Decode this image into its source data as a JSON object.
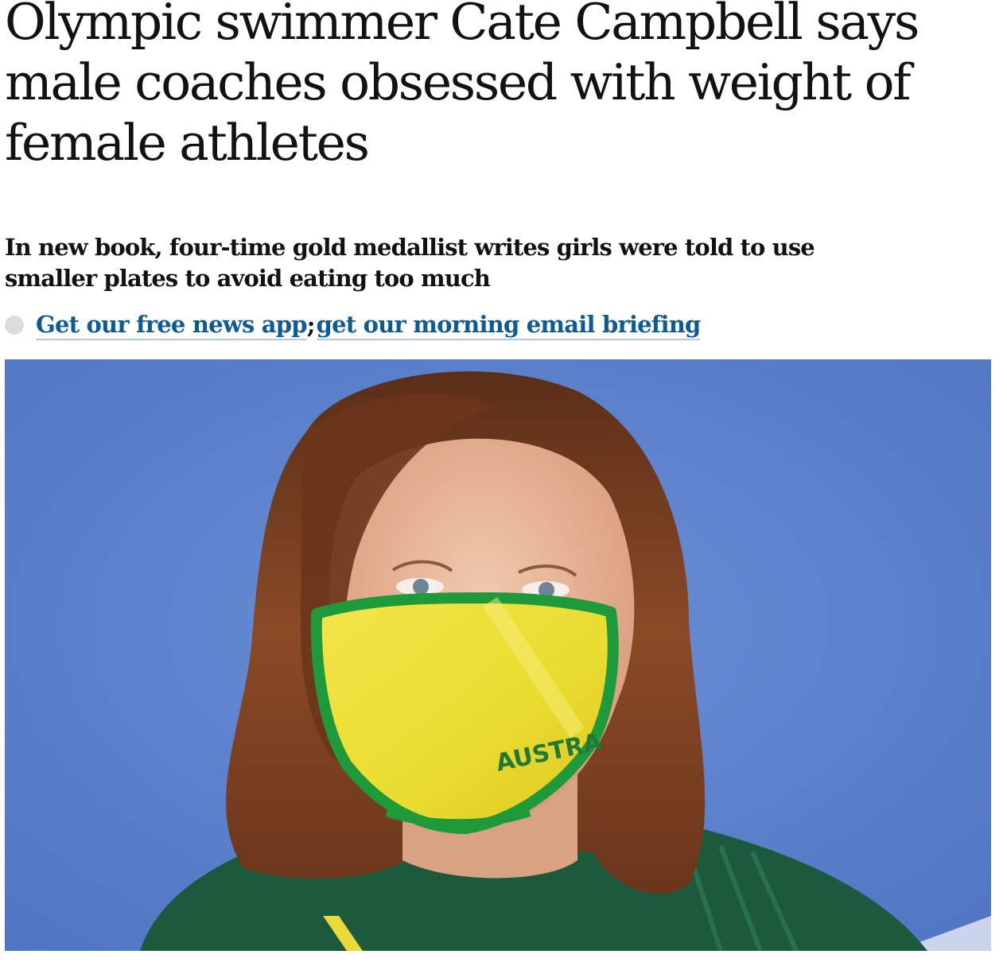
{
  "article": {
    "headline": "Olympic swimmer Cate Campbell says male coaches obsessed with weight of female athletes",
    "standfirst": "In new book, four-time gold medallist writes girls were told to use smaller plates to avoid eating too much",
    "links": {
      "news_app": "Get our free news app",
      "separator": ";",
      "email_briefing": "get our morning email briefing"
    },
    "image": {
      "mask_text": "AUSTRA"
    }
  },
  "colors": {
    "link": "#0d5b96",
    "background": "#5f82cc",
    "mask_yellow": "#f2e13a",
    "mask_green": "#1f9a3a",
    "hair": "#7a3f22",
    "shirt": "#1c5a3e"
  }
}
